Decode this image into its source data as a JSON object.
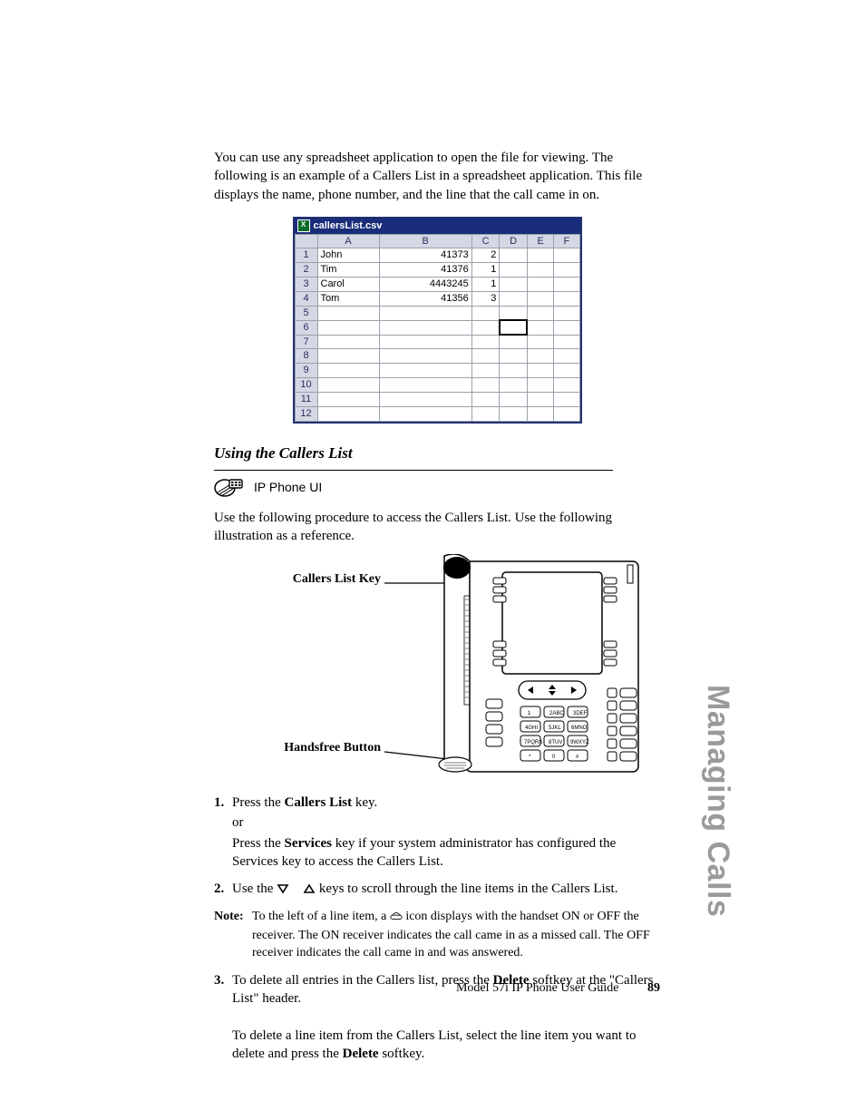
{
  "intro": "You can use any spreadsheet application to open the file for viewing. The following is an example of a Callers List in a spreadsheet application. This file displays the name, phone number, and the line that the call came in on.",
  "spreadsheet": {
    "filename": "callersList.csv",
    "columns": [
      "A",
      "B",
      "C",
      "D",
      "E",
      "F"
    ],
    "rowNumbers": [
      "1",
      "2",
      "3",
      "4",
      "5",
      "6",
      "7",
      "8",
      "9",
      "10",
      "11",
      "12"
    ],
    "rows": [
      {
        "A": "John",
        "B": "41373",
        "C": "2"
      },
      {
        "A": "Tim",
        "B": "41376",
        "C": "1"
      },
      {
        "A": "Carol",
        "B": "4443245",
        "C": "1"
      },
      {
        "A": "Tom",
        "B": "41356",
        "C": "3"
      }
    ]
  },
  "subheading": "Using the Callers List",
  "uiLabel": "IP Phone UI",
  "procedureIntro": "Use the following procedure to access the Callers List. Use the following illustration as a reference.",
  "diagram": {
    "callersLabel": "Callers List Key",
    "handsfreeLabel": "Handsfree Button"
  },
  "steps": {
    "s1": {
      "num": "1.",
      "a1": "Press the ",
      "a2": "Callers List",
      "a3": " key.",
      "or": "or",
      "b1": "Press the ",
      "b2": "Services",
      "b3": " key if your system administrator has configured the Services key to access the Callers List."
    },
    "s2": {
      "num": "2.",
      "a1": "Use the ",
      "a2": " keys to scroll through the line items in the Callers List."
    },
    "note": {
      "label": "Note:",
      "a1": "To the left of a line item, a ",
      "a2": " icon displays with the handset ON or OFF the receiver. The ON receiver indicates the call came in as a missed call. The OFF receiver indicates the call came in and was answered."
    },
    "s3": {
      "num": "3.",
      "a1": "To delete all entries in the Callers list, press the ",
      "a2": "Delete",
      "a3": " softkey at the \"Callers List\" header.",
      "b1": "To delete a line item from the Callers List, select the line item you want to delete and press the ",
      "b2": "Delete",
      "b3": " softkey."
    }
  },
  "footer": {
    "title": "Model 57i IP Phone User Guide",
    "page": "89"
  },
  "sidetab": "Managing Calls"
}
